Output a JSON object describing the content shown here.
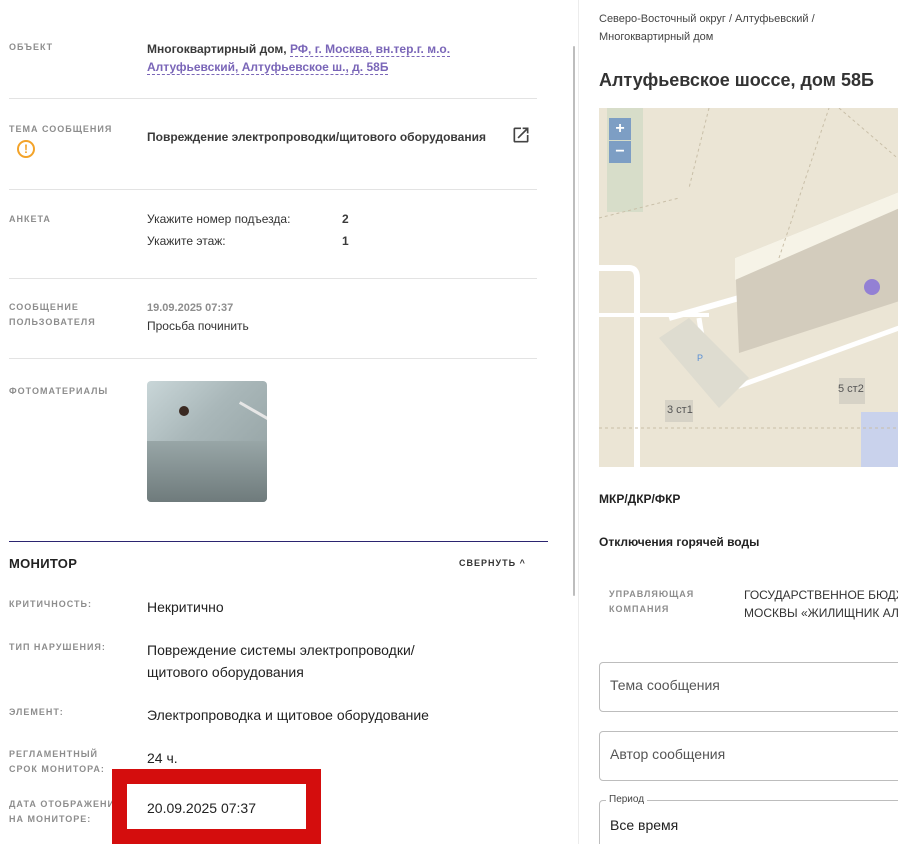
{
  "details": {
    "object": {
      "label": "ОБЪЕКТ",
      "prefix": "Многоквартирный дом,",
      "link_line1": "РФ, г. Москва, вн.тер.г. м.о.",
      "link_line2": "Алтуфьевский, Алтуфьевское ш., д. 58Б"
    },
    "topic": {
      "label": "ТЕМА СООБЩЕНИЯ",
      "value": "Повреждение электропроводки/щитового оборудования"
    },
    "form": {
      "label": "АНКЕТА",
      "q1": "Укажите номер подъезда:",
      "a1": "2",
      "q2": "Укажите этаж:",
      "a2": "1"
    },
    "user_message": {
      "label_line1": "СООБЩЕНИЕ",
      "label_line2": "ПОЛЬЗОВАТЕЛЯ",
      "timestamp": "19.09.2025 07:37",
      "text": "Просьба починить"
    },
    "photos": {
      "label": "ФОТОМАТЕРИАЛЫ"
    }
  },
  "monitor": {
    "title": "МОНИТОР",
    "collapse_label": "СВЕРНУТЬ ^",
    "criticality": {
      "label": "КРИТИЧНОСТЬ:",
      "value": "Некритично"
    },
    "violation_type": {
      "label": "ТИП НАРУШЕНИЯ:",
      "value_line1": "Повреждение системы электропроводки/",
      "value_line2": "щитового оборудования"
    },
    "element": {
      "label": "ЭЛЕМЕНТ:",
      "value": "Электропроводка и щитовое оборудование"
    },
    "deadline": {
      "label_line1": "РЕГЛАМЕНТНЫЙ",
      "label_line2": "СРОК МОНИТОРА:",
      "value": "24 ч."
    },
    "display_date": {
      "label_line1": "ДАТА ОТОБРАЖЕНИ",
      "label_line2": "НА МОНИТОРЕ:",
      "value": "20.09.2025 07:37"
    }
  },
  "right": {
    "breadcrumb_line1": "Северо-Восточный округ / Алтуфьевский /",
    "breadcrumb_line2": "Многоквартирный дом",
    "address": "Алтуфьевское шоссе, дом 58Б",
    "map": {
      "zoom_in": "+",
      "zoom_out": "−",
      "label_3st1": "3 ст1",
      "label_5st2": "5 ст2",
      "parking": "P"
    },
    "mkr": "МКР/ДКР/ФКР",
    "hot_water": "Отключения горячей воды",
    "management": {
      "label_line1": "УПРАВЛЯЮЩАЯ",
      "label_line2": "КОМПАНИЯ",
      "value_line1": "ГОСУДАРСТВЕННОЕ БЮДЖ",
      "value_line2": "МОСКВЫ «ЖИЛИЩНИК АЛ"
    },
    "filters": {
      "topic_placeholder": "Тема сообщения",
      "author_placeholder": "Автор сообщения",
      "period_legend": "Период",
      "period_value": "Все время"
    }
  },
  "colors": {
    "accent": "#7a66b8",
    "warning": "#f3a329",
    "highlight": "#d40d0d",
    "map_button": "#7d9ec4"
  }
}
